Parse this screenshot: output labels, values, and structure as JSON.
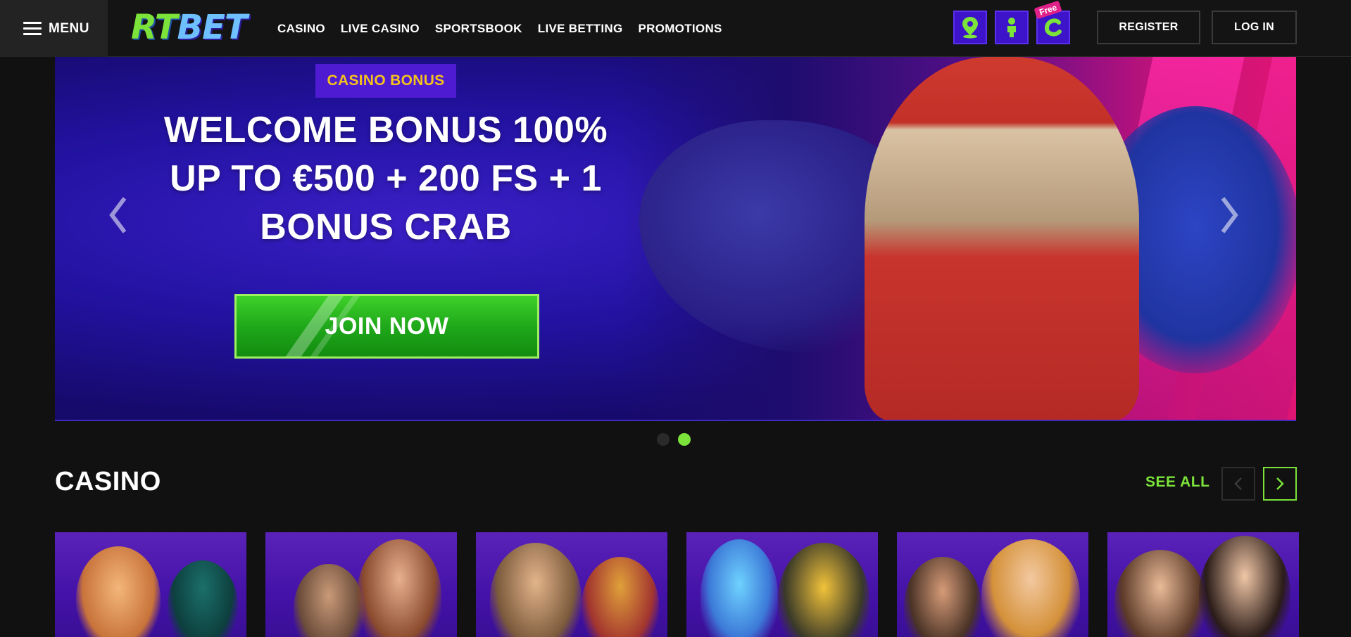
{
  "header": {
    "menu_label": "MENU",
    "logo_rt": "RT",
    "logo_bet": "BET",
    "nav": [
      "CASINO",
      "LIVE CASINO",
      "SPORTSBOOK",
      "LIVE BETTING",
      "PROMOTIONS"
    ],
    "free_tag": "Free",
    "icons": [
      "map-pin-icon",
      "person-icon",
      "coin-icon"
    ],
    "register_label": "REGISTER",
    "login_label": "LOG IN"
  },
  "hero": {
    "badge": "CASINO BONUS",
    "headline_lines": [
      "WELCOME BONUS 100%",
      "UP TO €500 + 200 FS + 1",
      "BONUS CRAB"
    ],
    "cta_label": "JOIN NOW",
    "slide_count": 2,
    "active_slide": 2
  },
  "casino": {
    "title": "CASINO",
    "see_all_label": "SEE ALL"
  },
  "colors": {
    "accent_green": "#7be33a",
    "badge_purple": "#4e1bd3",
    "badge_text": "#f5c21c",
    "icon_box": "#3d14c9"
  }
}
